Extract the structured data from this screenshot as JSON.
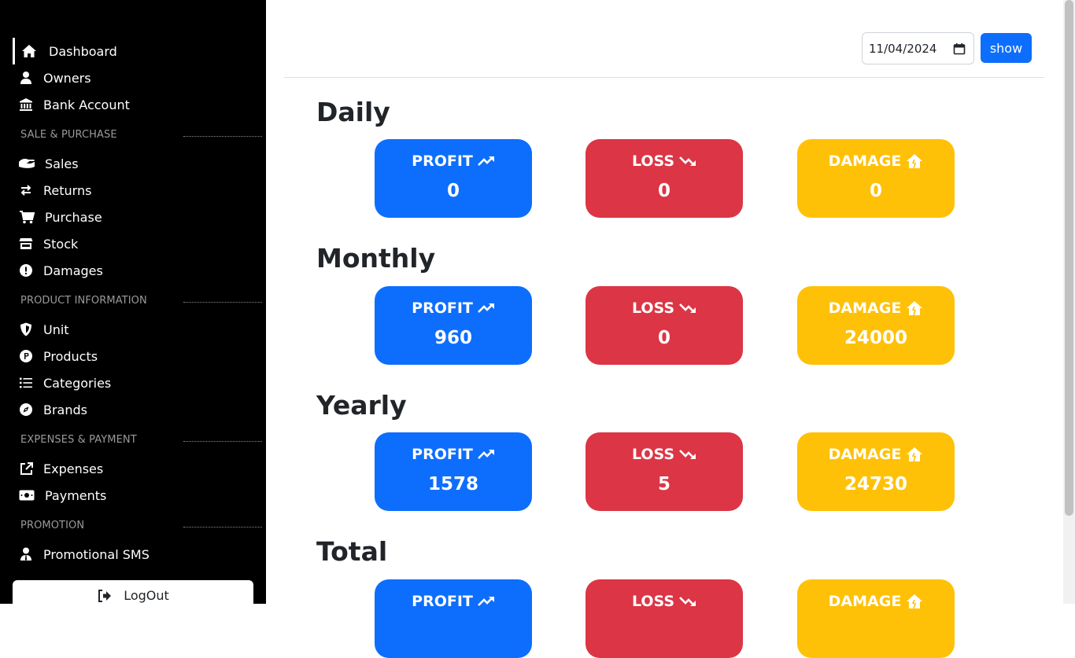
{
  "sidebar": {
    "items": [
      {
        "label": "Dashboard",
        "icon": "home-icon"
      },
      {
        "label": "Owners",
        "icon": "user-icon"
      },
      {
        "label": "Bank Account",
        "icon": "bank-icon"
      },
      {
        "label": "Sales",
        "icon": "money-hand-icon"
      },
      {
        "label": "Returns",
        "icon": "arrows-exchange-icon"
      },
      {
        "label": "Purchase",
        "icon": "cart-icon"
      },
      {
        "label": "Stock",
        "icon": "store-icon"
      },
      {
        "label": "Damages",
        "icon": "exclamation-circle-icon"
      },
      {
        "label": "Unit",
        "icon": "shield-icon"
      },
      {
        "label": "Products",
        "icon": "product-p-icon"
      },
      {
        "label": "Categories",
        "icon": "list-icon"
      },
      {
        "label": "Brands",
        "icon": "compass-icon"
      },
      {
        "label": "Expenses",
        "icon": "external-link-icon"
      },
      {
        "label": "Payments",
        "icon": "money-bill-icon"
      },
      {
        "label": "Promotional SMS",
        "icon": "user-tie-icon"
      }
    ],
    "sections": [
      "SALE & PURCHASE",
      "PRODUCT INFORMATION",
      "EXPENSES & PAYMENT",
      "PROMOTION"
    ],
    "logout_label": "LogOut"
  },
  "toolbar": {
    "date_value": "11/04/2024",
    "show_label": "show"
  },
  "groups": [
    {
      "title": "Daily",
      "profit": "0",
      "loss": "0",
      "damage": "0"
    },
    {
      "title": "Monthly",
      "profit": "960",
      "loss": "0",
      "damage": "24000"
    },
    {
      "title": "Yearly",
      "profit": "1578",
      "loss": "5",
      "damage": "24730"
    },
    {
      "title": "Total",
      "profit": "",
      "loss": "",
      "damage": ""
    }
  ],
  "cards": {
    "profit_label": "PROFIT",
    "loss_label": "LOSS",
    "damage_label": "DAMAGE"
  },
  "colors": {
    "profit": "#0d6efd",
    "loss": "#dc3545",
    "damage": "#ffc107",
    "sidebar_bg": "#000000"
  }
}
